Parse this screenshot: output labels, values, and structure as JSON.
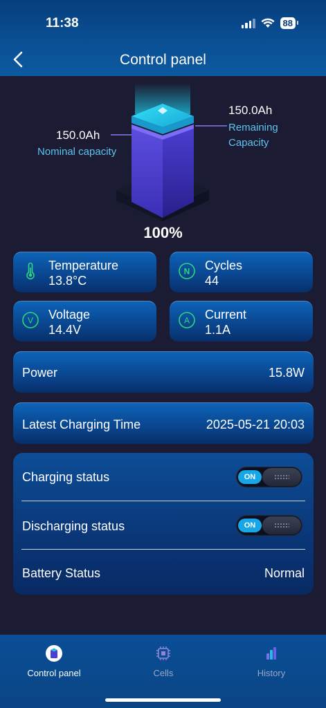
{
  "status_bar": {
    "time": "11:38",
    "battery": "88"
  },
  "header": {
    "title": "Control panel"
  },
  "capacity": {
    "nominal_value": "150.0Ah",
    "nominal_label": "Nominal capacity",
    "remaining_value": "150.0Ah",
    "remaining_label_1": "Remaining",
    "remaining_label_2": "Capacity",
    "percent": "100%"
  },
  "metrics": [
    {
      "label": "Temperature",
      "value": "13.8°C",
      "icon": "thermometer-icon"
    },
    {
      "label": "Cycles",
      "value": "44",
      "icon": "cycles-n-icon",
      "glyph": "N"
    },
    {
      "label": "Voltage",
      "value": "14.4V",
      "icon": "voltage-v-icon",
      "glyph": "V"
    },
    {
      "label": "Current",
      "value": "1.1A",
      "icon": "current-a-icon",
      "glyph": "A"
    }
  ],
  "power": {
    "label": "Power",
    "value": "15.8W"
  },
  "charging_time": {
    "label": "Latest Charging Time",
    "value": "2025-05-21 20:03"
  },
  "status": {
    "charging": {
      "label": "Charging status",
      "toggle": "ON",
      "on": true
    },
    "discharging": {
      "label": "Discharging status",
      "toggle": "ON",
      "on": true
    },
    "battery": {
      "label": "Battery Status",
      "value": "Normal"
    }
  },
  "tabs": [
    {
      "label": "Control panel",
      "icon": "battery-cylinder-icon",
      "active": true
    },
    {
      "label": "Cells",
      "icon": "chip-icon",
      "active": false
    },
    {
      "label": "History",
      "icon": "bar-chart-icon",
      "active": false
    }
  ],
  "colors": {
    "accent_cyan": "#5fc4ee",
    "toggle_on": "#17a6e8",
    "background": "#1b1c33",
    "card_blue": "#0d63b8",
    "metric_icon_green": "#2fd67a"
  }
}
